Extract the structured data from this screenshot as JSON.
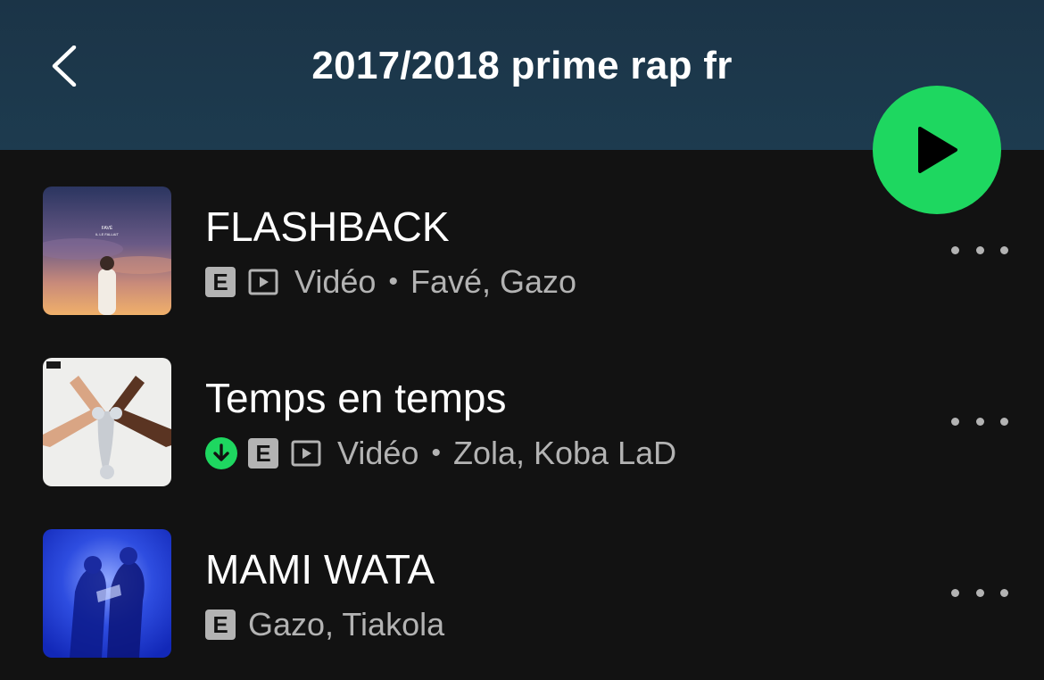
{
  "header": {
    "back_icon": "chevron-left-icon",
    "title": "2017/2018 prime rap fr",
    "background": "#1d3b4f"
  },
  "play_button": {
    "icon": "play-icon",
    "color": "#1ed760"
  },
  "tracks": [
    {
      "title": "FLASHBACK",
      "explicit_label": "E",
      "downloaded": false,
      "has_video": true,
      "video_label": "Vidéo",
      "separator": "•",
      "artists": "Favé, Gazo",
      "cover_text_1": "FAVÉ",
      "cover_text_2": "IL LE FALLAIT",
      "more_icon": "more-horizontal-icon"
    },
    {
      "title": "Temps en temps",
      "explicit_label": "E",
      "downloaded": true,
      "has_video": true,
      "video_label": "Vidéo",
      "separator": "•",
      "artists": "Zola, Koba LaD",
      "more_icon": "more-horizontal-icon"
    },
    {
      "title": "MAMI WATA",
      "explicit_label": "E",
      "downloaded": false,
      "has_video": false,
      "artists": "Gazo, Tiakola",
      "more_icon": "more-horizontal-icon"
    }
  ],
  "colors": {
    "background": "#121212",
    "text_primary": "#ffffff",
    "text_secondary": "#b3b3b3",
    "accent_green": "#1ed760"
  }
}
